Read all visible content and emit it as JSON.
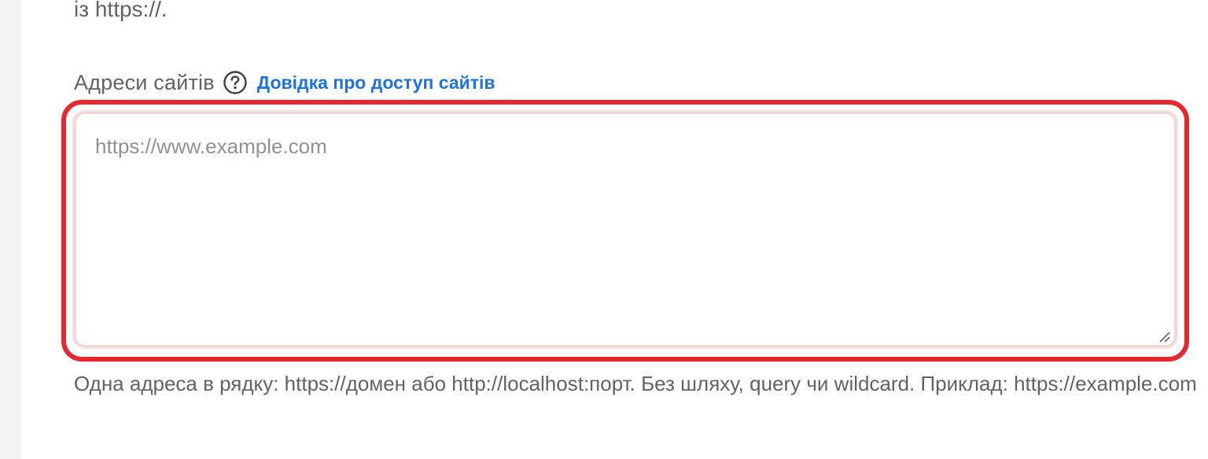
{
  "previous_text": "із https://.",
  "site_addresses": {
    "label": "Адреси сайтів",
    "help_icon": "question-circle-icon",
    "help_link": "Довідка про доступ сайтів",
    "placeholder": "https://www.example.com",
    "value": "",
    "hint": "Одна адреса в рядку: https://домен або http://localhost:порт. Без шляху, query чи wildcard. Приклад: https://example.com"
  },
  "colors": {
    "focus_outline": "#e8262d",
    "link": "#1a73e8",
    "text_muted": "#5f6368",
    "placeholder": "#8e9297"
  }
}
